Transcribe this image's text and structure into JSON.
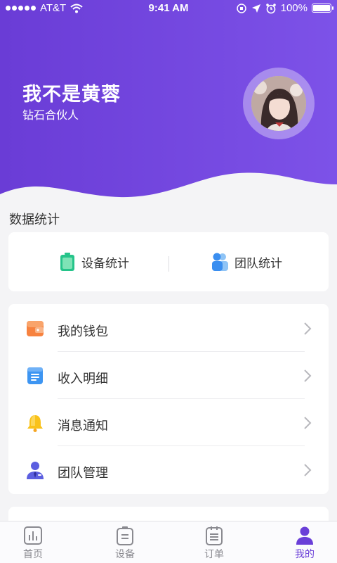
{
  "status_bar": {
    "carrier": "AT&T",
    "time": "9:41 AM",
    "battery": "100%"
  },
  "profile": {
    "name": "我不是黄蓉",
    "level": "钻石合伙人"
  },
  "stats_section": {
    "title": "数据统计",
    "device_stats": "设备统计",
    "team_stats": "团队统计"
  },
  "menu": [
    {
      "label": "我的钱包",
      "icon": "wallet-icon"
    },
    {
      "label": "收入明细",
      "icon": "income-list-icon"
    },
    {
      "label": "消息通知",
      "icon": "bell-icon"
    },
    {
      "label": "团队管理",
      "icon": "team-manager-icon"
    }
  ],
  "tabs": [
    {
      "label": "首页",
      "icon": "chart-icon"
    },
    {
      "label": "设备",
      "icon": "device-icon"
    },
    {
      "label": "订单",
      "icon": "order-icon"
    },
    {
      "label": "我的",
      "icon": "person-icon",
      "active": true
    }
  ],
  "colors": {
    "accent": "#6a3fd8",
    "header_gradient_start": "#6a3fd8",
    "header_gradient_end": "#7b4fe6"
  }
}
